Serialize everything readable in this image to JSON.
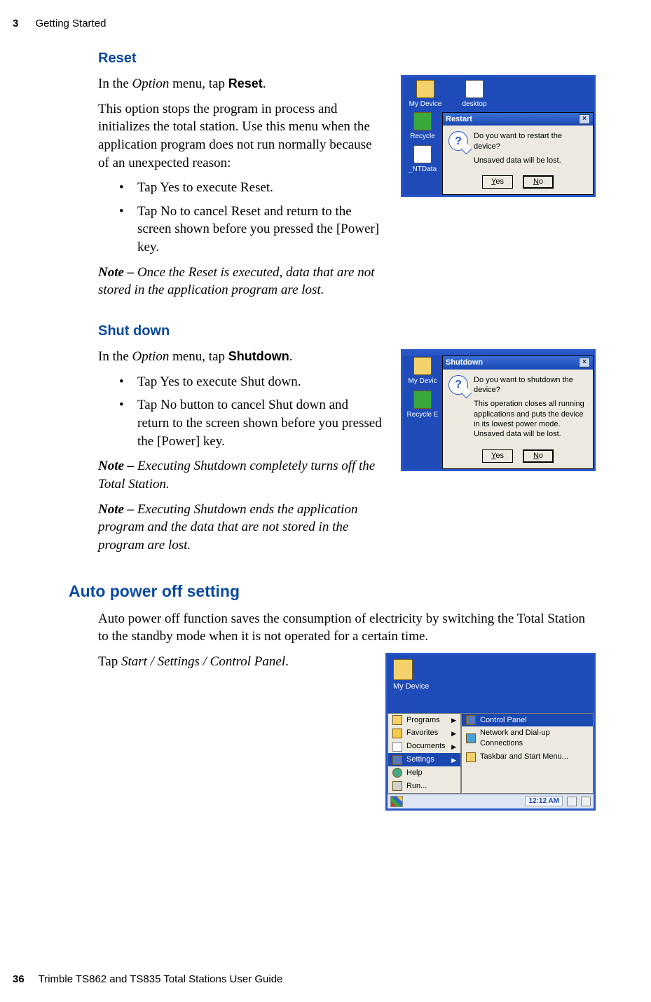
{
  "header": {
    "chapter_num": "3",
    "chapter_title": "Getting Started"
  },
  "footer": {
    "page_num": "36",
    "book_title": "Trimble TS862 and TS835 Total Stations User Guide"
  },
  "reset": {
    "heading": "Reset",
    "intro_pre": "In the ",
    "intro_option": "Option",
    "intro_mid": " menu, tap  ",
    "intro_bold": "Reset",
    "intro_post": ".",
    "desc": "This option stops the program in process and initializes the total station. Use this menu when the application program does not run normally because of an unexpected reason:",
    "b1_pre": "Tap ",
    "b1_bold": "Yes",
    "b1_post": " to execute Reset.",
    "b2_pre": "Tap ",
    "b2_bold": "No",
    "b2_post": " to cancel Reset and return to the screen shown before you pressed the [Power] key.",
    "note_label": "Note – ",
    "note_text": "Once the Reset is executed, data that are not stored in the application program are lost.",
    "dlg": {
      "icons": {
        "mydevice": "My Device",
        "desktop": "desktop",
        "recycle": "Recycle",
        "ntdata": "_NTData"
      },
      "title": "Restart",
      "line1": "Do you want to restart the device?",
      "line2": "Unsaved data will be lost.",
      "yes": "Yes",
      "no": "No"
    }
  },
  "shutdown": {
    "heading": "Shut down",
    "intro_pre": "In the ",
    "intro_option": "Option",
    "intro_mid": " menu, tap  ",
    "intro_bold": "Shutdown",
    "intro_post": ".",
    "b1_pre": "Tap ",
    "b1_bold": "Yes",
    "b1_post": " to execute Shut down.",
    "b2_pre": "Tap ",
    "b2_bold": "No",
    "b2_post": " button to cancel Shut down and return to the screen shown before you pressed the [Power] key.",
    "note1_label": "Note – ",
    "note1_text": "Executing Shutdown completely turns off the Total Station.",
    "note2_label": "Note – ",
    "note2_text": "Executing Shutdown ends the application program and the data that are not stored in the program are lost.",
    "dlg": {
      "icons": {
        "mydevice": "My Devic",
        "recycle": "Recycle E"
      },
      "title": "Shutdown",
      "line1": "Do you want to shutdown the device?",
      "line2": "This operation closes all running applications and puts the device in its lowest power mode. Unsaved data will be lost.",
      "yes": "Yes",
      "no": "No"
    }
  },
  "autopower": {
    "heading": "Auto power off setting",
    "desc": "Auto power off function saves the consumption of electricity by switching the Total Station to the standby mode when it is not operated for a certain time.",
    "tap_pre": "Tap ",
    "tap_italic": "Start / Settings / Control Panel",
    "tap_post": ".",
    "shot": {
      "mydevice": "My Device",
      "left": {
        "programs": "Programs",
        "favorites": "Favorites",
        "documents": "Documents",
        "settings": "Settings",
        "help": "Help",
        "run": "Run..."
      },
      "right": {
        "cp": "Control Panel",
        "net": "Network and Dial-up Connections",
        "task": "Taskbar and Start Menu..."
      },
      "clock": "12:12 AM"
    }
  }
}
